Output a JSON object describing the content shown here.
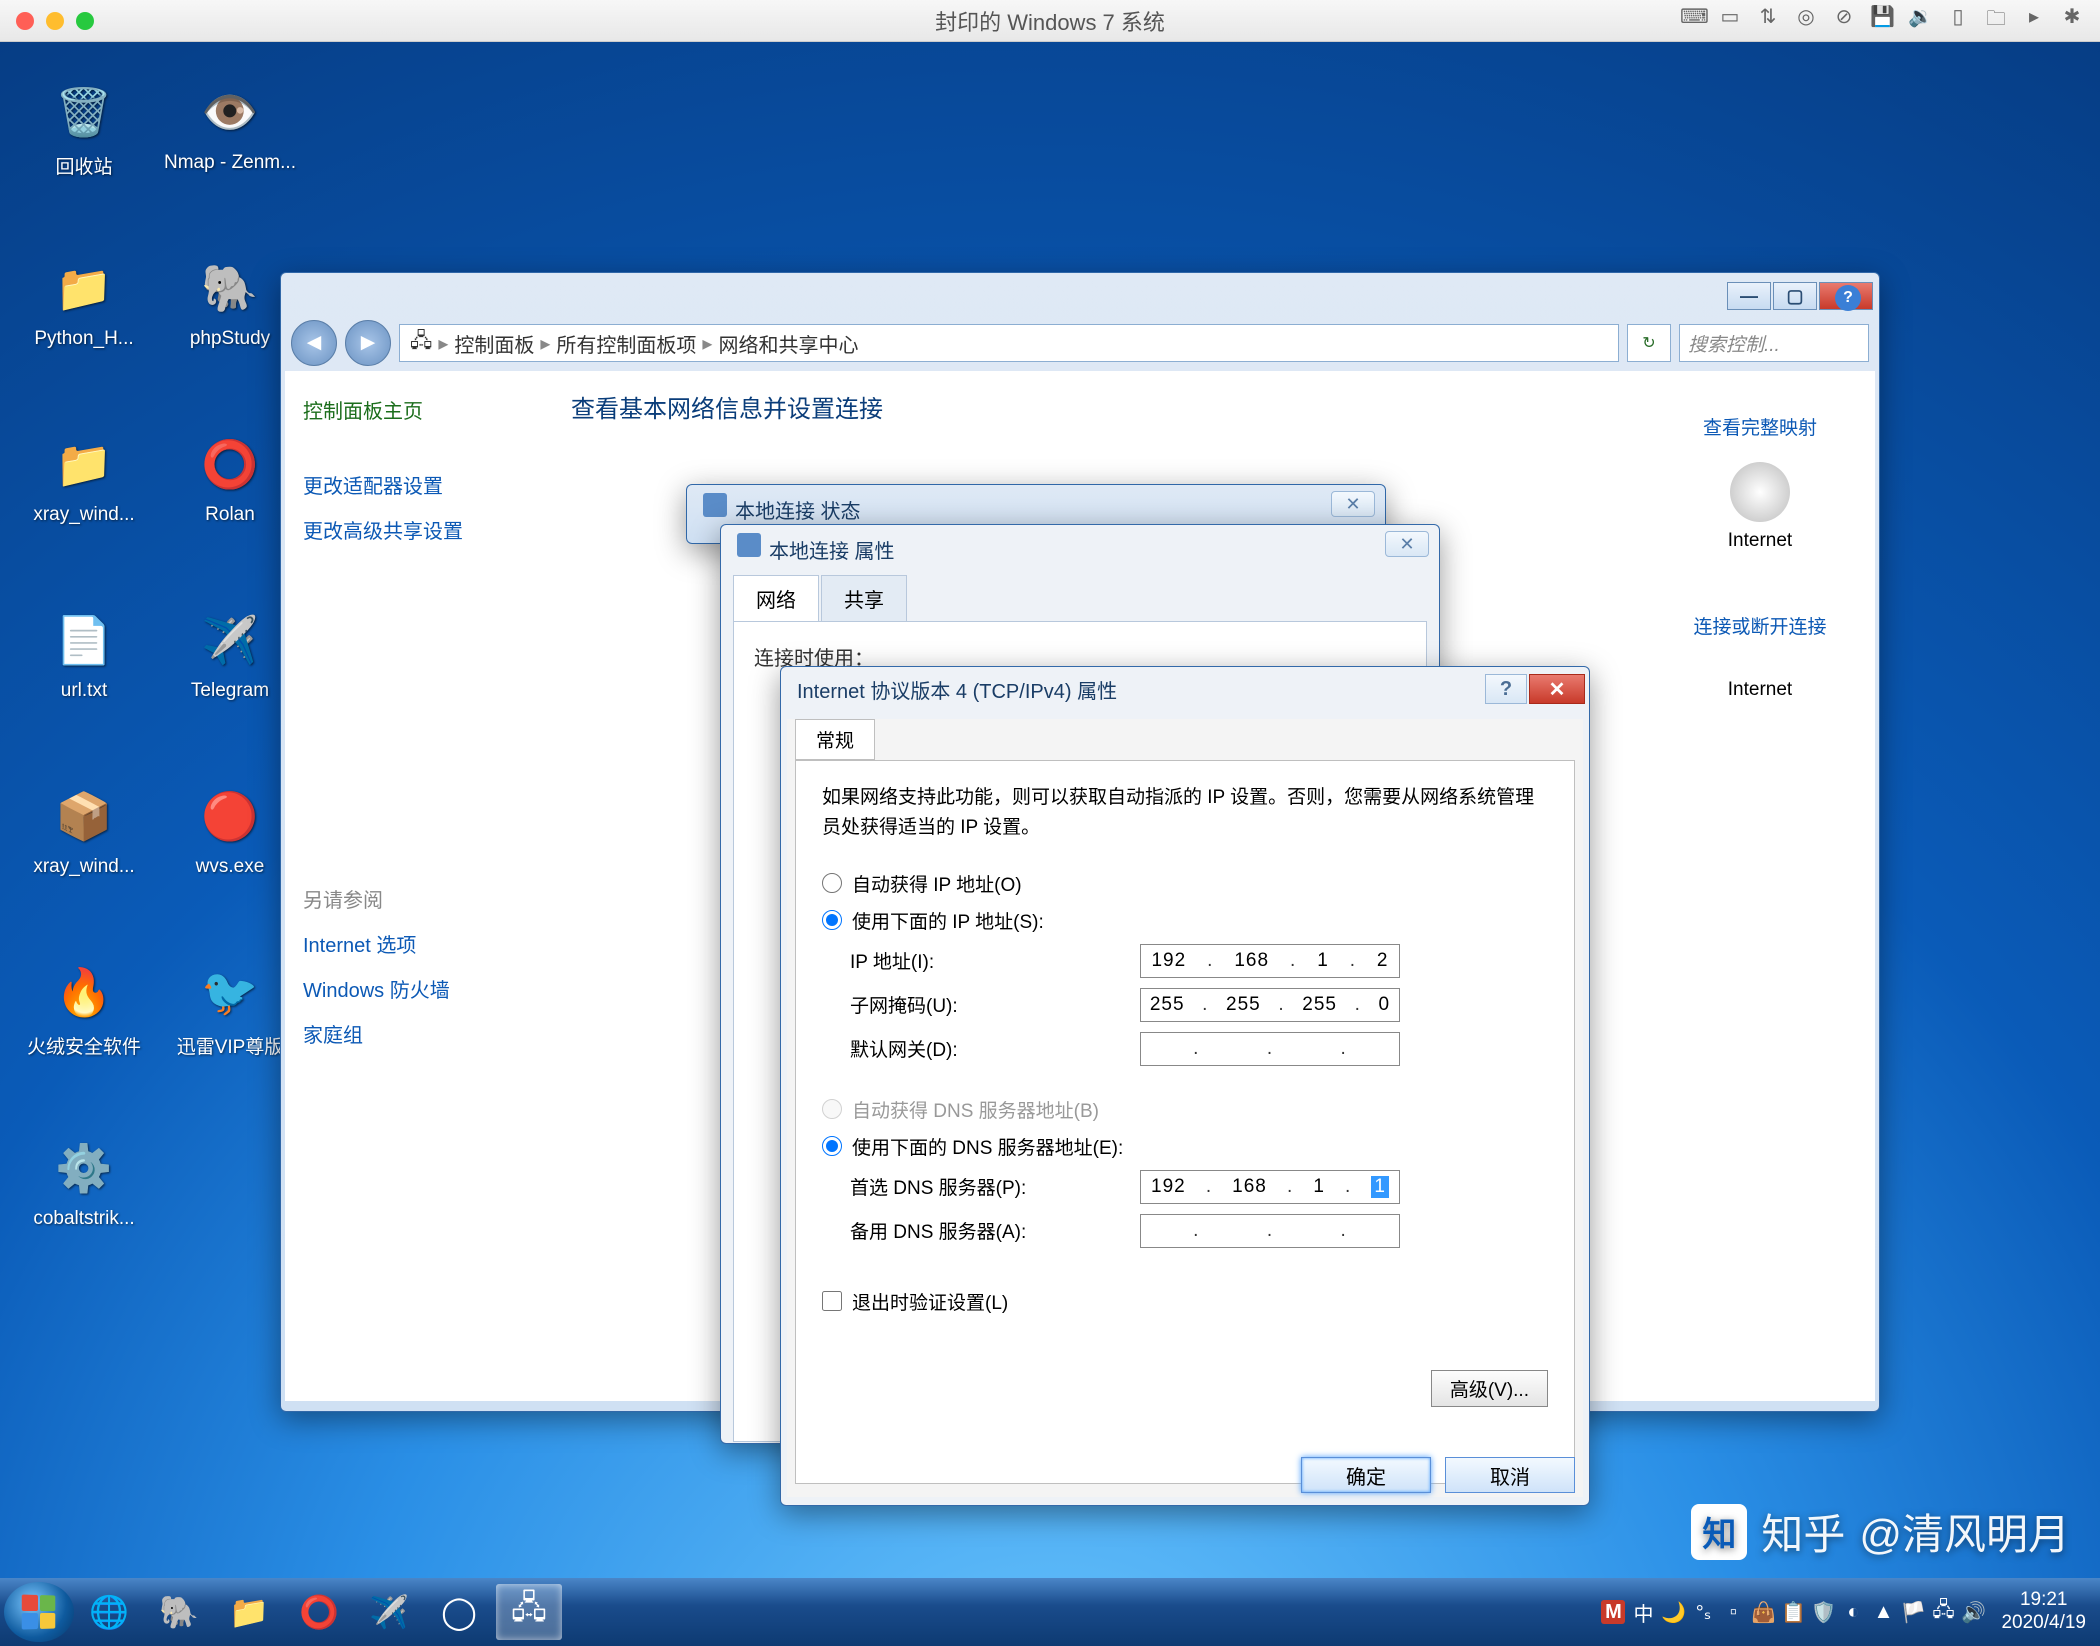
{
  "mac": {
    "title": "封印的 Windows 7 系统"
  },
  "desktop_icons": [
    {
      "name": "回收站",
      "icon": "🗑️"
    },
    {
      "name": "Nmap - Zenm...",
      "icon": "👁️"
    },
    {
      "name": "Python_H...",
      "icon": "📁"
    },
    {
      "name": "phpStudy",
      "icon": "🐘"
    },
    {
      "name": "xray_wind...",
      "icon": "📁"
    },
    {
      "name": "Rolan",
      "icon": "⭕"
    },
    {
      "name": "url.txt",
      "icon": "📄"
    },
    {
      "name": "Telegram",
      "icon": "✈️"
    },
    {
      "name": "xray_wind...",
      "icon": "📦"
    },
    {
      "name": "wvs.exe",
      "icon": "🔴"
    },
    {
      "name": "火绒安全软件",
      "icon": "🔥"
    },
    {
      "name": "迅雷VIP尊版",
      "icon": "🐦"
    },
    {
      "name": "cobaltstrik...",
      "icon": "⚙️"
    }
  ],
  "explorer": {
    "breadcrumb": [
      "控制面板",
      "所有控制面板项",
      "网络和共享中心"
    ],
    "search_placeholder": "搜索控制...",
    "side_home": "控制面板主页",
    "side_links": [
      "更改适配器设置",
      "更改高级共享设置"
    ],
    "see_also": "另请参阅",
    "see_also_links": [
      "Internet 选项",
      "Windows 防火墙",
      "家庭组"
    ],
    "main_heading": "查看基本网络信息并设置连接",
    "right_links": [
      "查看完整映射",
      "连接或断开连接"
    ],
    "right_label1": "Internet",
    "right_label2": "Internet"
  },
  "status": {
    "title": "本地连接 状态"
  },
  "props": {
    "title": "本地连接 属性",
    "tab_net": "网络",
    "tab_share": "共享",
    "connect_using": "连接时使用："
  },
  "ipv4": {
    "title": "Internet 协议版本 4 (TCP/IPv4) 属性",
    "tab": "常规",
    "desc": "如果网络支持此功能，则可以获取自动指派的 IP 设置。否则，您需要从网络系统管理员处获得适当的 IP 设置。",
    "r_auto_ip": "自动获得 IP 地址(O)",
    "r_manual_ip": "使用下面的 IP 地址(S):",
    "lbl_ip": "IP 地址(I):",
    "val_ip": [
      "192",
      "168",
      "1",
      "2"
    ],
    "lbl_mask": "子网掩码(U):",
    "val_mask": [
      "255",
      "255",
      "255",
      "0"
    ],
    "lbl_gw": "默认网关(D):",
    "val_gw": [
      "",
      "",
      "",
      ""
    ],
    "r_auto_dns": "自动获得 DNS 服务器地址(B)",
    "r_manual_dns": "使用下面的 DNS 服务器地址(E):",
    "lbl_dns1": "首选 DNS 服务器(P):",
    "val_dns1": [
      "192",
      "168",
      "1",
      "1"
    ],
    "lbl_dns2": "备用 DNS 服务器(A):",
    "val_dns2": [
      "",
      "",
      "",
      ""
    ],
    "chk_validate": "退出时验证设置(L)",
    "btn_adv": "高级(V)...",
    "btn_ok": "确定",
    "btn_cancel": "取消"
  },
  "tray": {
    "ime": "中",
    "m": "M",
    "time": "19:21",
    "date": "2020/4/19"
  },
  "watermark": {
    "site": "知乎",
    "author": "@清风明月"
  }
}
